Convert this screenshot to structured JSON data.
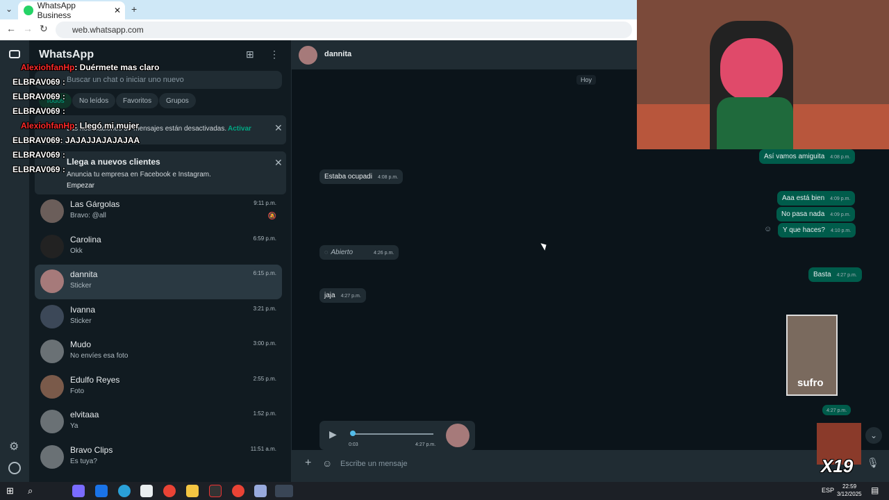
{
  "browser": {
    "tab_title": "WhatsApp Business",
    "url": "web.whatsapp.com"
  },
  "sidebar": {
    "title": "WhatsApp",
    "search_placeholder": "Buscar un chat o iniciar uno nuevo",
    "filters": [
      "Todos",
      "No leídos",
      "Favoritos",
      "Grupos"
    ],
    "notif_banner": {
      "text": "Las notificaciones de mensajes están desactivadas.",
      "action": "Activar"
    },
    "promo": {
      "title": "Llega a nuevos clientes",
      "text": "Anuncia tu empresa en Facebook e Instagram.",
      "action": "Empezar"
    },
    "chats": [
      {
        "name": "Las Gárgolas",
        "preview": "Bravo: @all",
        "time": "9:11 p.m."
      },
      {
        "name": "Carolina",
        "preview": "Okk",
        "time": "6:59 p.m."
      },
      {
        "name": "dannita",
        "preview": "Sticker",
        "time": "6:15 p.m."
      },
      {
        "name": "Ivanna",
        "preview": "Sticker",
        "time": "3:21 p.m."
      },
      {
        "name": "Mudo",
        "preview": "No envíes esa foto",
        "time": "3:00 p.m."
      },
      {
        "name": "Edulfo Reyes",
        "preview": "Foto",
        "time": "2:55 p.m."
      },
      {
        "name": "elvitaaa",
        "preview": "Ya",
        "time": "1:52 p.m."
      },
      {
        "name": "Bravo Clips",
        "preview": "Es tuya?",
        "time": "11:51 a.m."
      }
    ]
  },
  "chat": {
    "contact": "dannita",
    "day": "Hoy",
    "messages": [
      {
        "text": "Así vamos amiguita",
        "time": "4:08 p.m.",
        "dir": "out"
      },
      {
        "text": "Estaba ocupadi",
        "time": "4:08 p.m.",
        "dir": "in"
      },
      {
        "text": "Aaa está bien",
        "time": "4:09 p.m.",
        "dir": "out"
      },
      {
        "text": "No pasa nada",
        "time": "4:09 p.m.",
        "dir": "out"
      },
      {
        "text": "Y que haces?",
        "time": "4:10 p.m.",
        "dir": "out"
      },
      {
        "text": "Abierto",
        "time": "4:26 p.m.",
        "dir": "in"
      },
      {
        "text": "Basta",
        "time": "4:27 p.m.",
        "dir": "out"
      },
      {
        "text": "jaja",
        "time": "4:27 p.m.",
        "dir": "in"
      }
    ],
    "sticker_caption": "sufro",
    "sticker_time": "4:27 p.m.",
    "audio": {
      "duration": "0:03",
      "time": "4:27 p.m."
    },
    "composer_placeholder": "Escribe un mensaje"
  },
  "stream_overlay": {
    "lines": [
      {
        "user": "AlexiohfanHp",
        "msg": ": Duérmete mas claro"
      },
      {
        "user": "ELBRAV069",
        "msg": ":"
      },
      {
        "user": "ELBRAV069",
        "msg": ":"
      },
      {
        "user": "ELBRAV069",
        "msg": ":"
      },
      {
        "user": "AlexiohfanHp",
        "msg": ": Llegó mi mujer"
      },
      {
        "user": "ELBRAV069",
        "msg": ": JAJAJJAJAJAJAA"
      },
      {
        "user": "ELBRAV069",
        "msg": ":"
      },
      {
        "user": "ELBRAV069",
        "msg": ":"
      }
    ],
    "combo": "X19"
  },
  "taskbar": {
    "lang": "ESP",
    "time": "22:59",
    "date": "3/12/2025"
  }
}
